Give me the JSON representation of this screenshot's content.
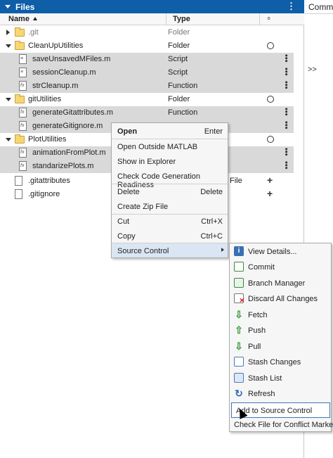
{
  "panel": {
    "title": "Files"
  },
  "columns": {
    "name": "Name",
    "type": "Type"
  },
  "rows": [
    {
      "name": ".git",
      "type": "Folder"
    },
    {
      "name": "CleanUpUtilities",
      "type": "Folder"
    },
    {
      "name": "saveUnsavedMFiles.m",
      "type": "Script"
    },
    {
      "name": "sessionCleanup.m",
      "type": "Script"
    },
    {
      "name": "strCleanup.m",
      "type": "Function"
    },
    {
      "name": "gitUtilities",
      "type": "Folder"
    },
    {
      "name": "generateGitattributes.m",
      "type": "Function"
    },
    {
      "name": "generateGitignore.m",
      "type": ""
    },
    {
      "name": "PlotUtilities",
      "type": ""
    },
    {
      "name": "animationFromPlot.m",
      "type": ""
    },
    {
      "name": "standarizePlots.m",
      "type": ""
    },
    {
      "name": ".gitattributes",
      "type": "File"
    },
    {
      "name": ".gitignore",
      "type": ""
    }
  ],
  "right_panel": {
    "label": "Comma",
    "chevron": ">>"
  },
  "context_menu": {
    "open": "Open",
    "open_key": "Enter",
    "open_outside": "Open Outside MATLAB",
    "show_explorer": "Show in Explorer",
    "check_codegen": "Check Code Generation Readiness",
    "delete": "Delete",
    "delete_key": "Delete",
    "create_zip": "Create Zip File",
    "cut": "Cut",
    "cut_key": "Ctrl+X",
    "copy": "Copy",
    "copy_key": "Ctrl+C",
    "source_control": "Source Control"
  },
  "submenu": {
    "view_details": "View Details...",
    "commit": "Commit",
    "branch_manager": "Branch Manager",
    "discard": "Discard All Changes",
    "fetch": "Fetch",
    "push": "Push",
    "pull": "Pull",
    "stash_changes": "Stash Changes",
    "stash_list": "Stash List",
    "refresh": "Refresh",
    "add_to_sc": "Add to Source Control",
    "check_conflict": "Check File for Conflict Markers"
  }
}
